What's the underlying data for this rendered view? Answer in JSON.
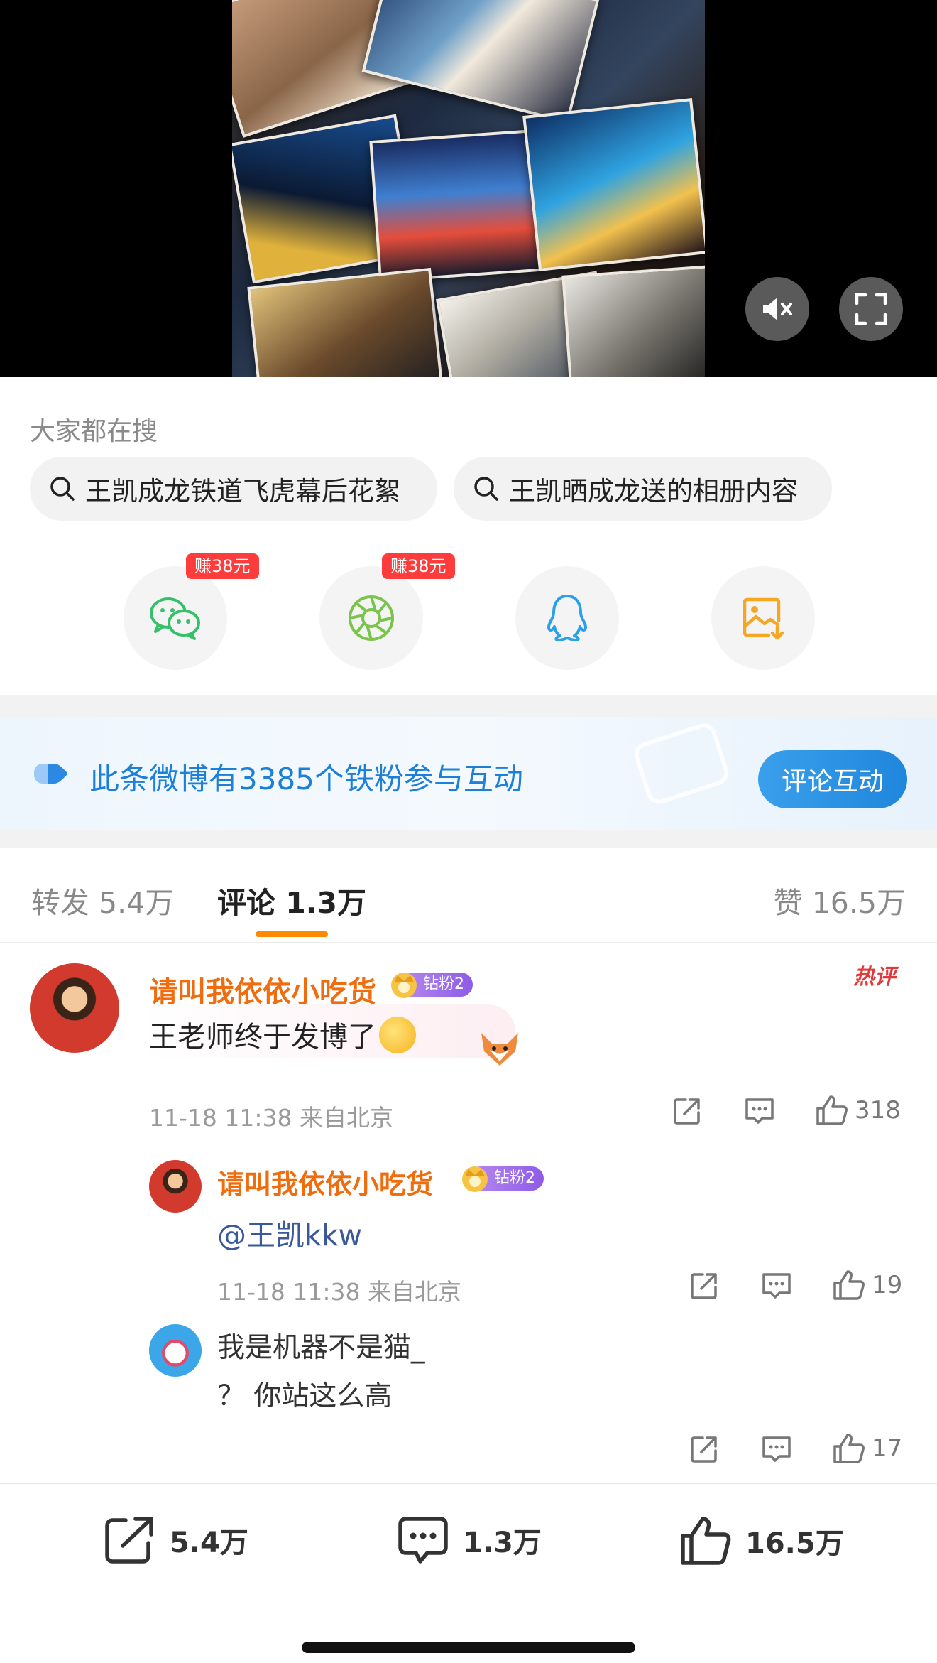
{
  "video": {
    "mute_icon": "speaker-mute-icon",
    "fullscreen_icon": "fullscreen-icon"
  },
  "search": {
    "title": "大家都在搜",
    "chips": [
      "王凯成龙铁道飞虎幕后花絮",
      "王凯晒成龙送的相册内容"
    ]
  },
  "share": {
    "badge": "赚38元",
    "items": [
      {
        "icon": "wechat-icon",
        "badge": true
      },
      {
        "icon": "moments-icon",
        "badge": true
      },
      {
        "icon": "qq-icon",
        "badge": false
      },
      {
        "icon": "save-image-icon",
        "badge": false
      }
    ]
  },
  "banner": {
    "text": "此条微博有3385个铁粉参与互动",
    "button": "评论互动",
    "accent": "#1c7fd8"
  },
  "tabs": {
    "repost": "转发 5.4万",
    "comment": "评论 1.3万",
    "like": "赞 16.5万",
    "underline_color": "#ff8a00"
  },
  "comments": {
    "main": {
      "username": "请叫我依依小吃货",
      "fan_badge": "钻粉2",
      "hot_tag": "热评",
      "text": "王老师终于发博了",
      "meta": "11-18 11:38 来自北京",
      "likes": "318"
    },
    "reply1": {
      "username": "请叫我依依小吃货",
      "fan_badge": "钻粉2",
      "text": "@王凯kkw",
      "meta": "11-18 11:38 来自北京",
      "likes": "19"
    },
    "reply2": {
      "username": "我是机器不是猫_",
      "text": "？ 你站这么高",
      "likes": "17"
    },
    "name_color": "#f06d0f"
  },
  "bottom_bar": {
    "repost": "5.4万",
    "comment": "1.3万",
    "like": "16.5万"
  }
}
